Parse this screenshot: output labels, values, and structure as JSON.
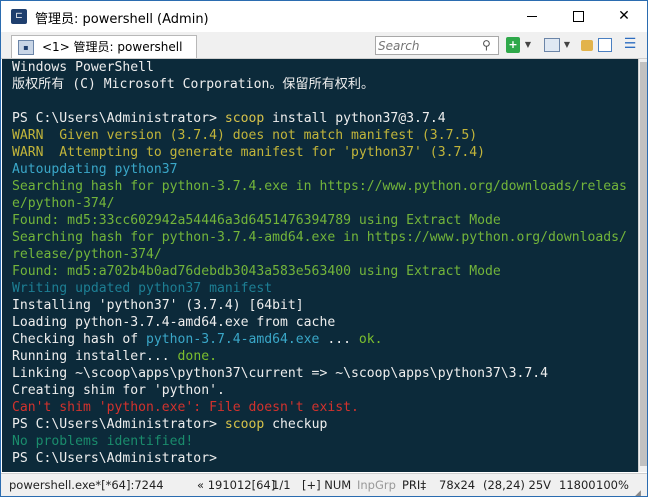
{
  "window": {
    "title": "管理员: powershell (Admin)",
    "app_icon_glyph": "⊏"
  },
  "title_buttons": {
    "minimize": "",
    "maximize": "",
    "close": "✕"
  },
  "tab": {
    "label": "<1> 管理员: powershell"
  },
  "toolbar": {
    "search_placeholder": "Search",
    "search_icon": "⚲",
    "new_tab": "+",
    "dropdown": "▼",
    "menu": "☰"
  },
  "console": {
    "lines": [
      [
        {
          "t": "Windows PowerShell",
          "c": "white"
        }
      ],
      [
        {
          "t": "版权所有 (C) Microsoft Corporation。保留所有权利。",
          "c": "white"
        }
      ],
      [
        {
          "t": "",
          "c": "white"
        }
      ],
      [
        {
          "t": "PS C:\\Users\\Administrator> ",
          "c": "white"
        },
        {
          "t": "scoop",
          "c": "yellow"
        },
        {
          "t": " install python37@3.7.4",
          "c": "white"
        }
      ],
      [
        {
          "t": "WARN  Given version (3.7.4) does not match manifest (3.7.5)",
          "c": "warn"
        }
      ],
      [
        {
          "t": "WARN  Attempting to generate manifest for 'python37' (3.7.4)",
          "c": "warn"
        }
      ],
      [
        {
          "t": "Autoupdating python37",
          "c": "cyan"
        }
      ],
      [
        {
          "t": "Searching hash for python-3.7.4.exe in https://www.python.org/downloads/releas",
          "c": "green"
        }
      ],
      [
        {
          "t": "e/python-374/",
          "c": "green"
        }
      ],
      [
        {
          "t": "Found: md5:33cc602942a54446a3d6451476394789 using Extract Mode",
          "c": "green"
        }
      ],
      [
        {
          "t": "Searching hash for python-3.7.4-amd64.exe in https://www.python.org/downloads/",
          "c": "green"
        }
      ],
      [
        {
          "t": "release/python-374/",
          "c": "green"
        }
      ],
      [
        {
          "t": "Found: md5:a702b4b0ad76debdb3043a583e563400 using Extract Mode",
          "c": "green"
        }
      ],
      [
        {
          "t": "Writing updated python37 manifest",
          "c": "dcyan"
        }
      ],
      [
        {
          "t": "Installing 'python37' (3.7.4) [64bit]",
          "c": "white"
        }
      ],
      [
        {
          "t": "Loading python-3.7.4-amd64.exe from cache",
          "c": "white"
        }
      ],
      [
        {
          "t": "Checking hash of ",
          "c": "white"
        },
        {
          "t": "python-3.7.4-amd64.exe",
          "c": "cyan"
        },
        {
          "t": " ... ",
          "c": "white"
        },
        {
          "t": "ok.",
          "c": "ok"
        }
      ],
      [
        {
          "t": "Running installer... ",
          "c": "white"
        },
        {
          "t": "done.",
          "c": "ok"
        }
      ],
      [
        {
          "t": "Linking ~\\scoop\\apps\\python37\\current => ~\\scoop\\apps\\python37\\3.7.4",
          "c": "white"
        }
      ],
      [
        {
          "t": "Creating shim for 'python'.",
          "c": "white"
        }
      ],
      [
        {
          "t": "Can't shim 'python.exe': File doesn't exist.",
          "c": "red"
        }
      ],
      [
        {
          "t": "PS C:\\Users\\Administrator> ",
          "c": "white"
        },
        {
          "t": "scoop",
          "c": "yellow"
        },
        {
          "t": " checkup",
          "c": "white"
        }
      ],
      [
        {
          "t": "No problems identified!",
          "c": "dgreen"
        }
      ],
      [
        {
          "t": "PS C:\\Users\\Administrator>",
          "c": "white"
        }
      ]
    ]
  },
  "statusbar": {
    "process": "powershell.exe*[*64]:7244",
    "build": "« 191012[64]",
    "page": "1/1",
    "num": "[+] NUM",
    "inpgrp": "InpGrp",
    "pri": "PRI‡",
    "size": "78x24",
    "cursor": "(28,24) 25V",
    "pid": "11800",
    "zoom": "100%"
  },
  "colors": {
    "console_bg": "#0c2a3a",
    "white": "#eeeeee",
    "yellow": "#d7c34b",
    "warn": "#c2b53a",
    "cyan": "#3aa7c8",
    "green": "#73b53a",
    "dcyan": "#1d7f94",
    "red": "#d2322d",
    "dgreen": "#1a8c6c",
    "ok": "#7cbf2e"
  }
}
